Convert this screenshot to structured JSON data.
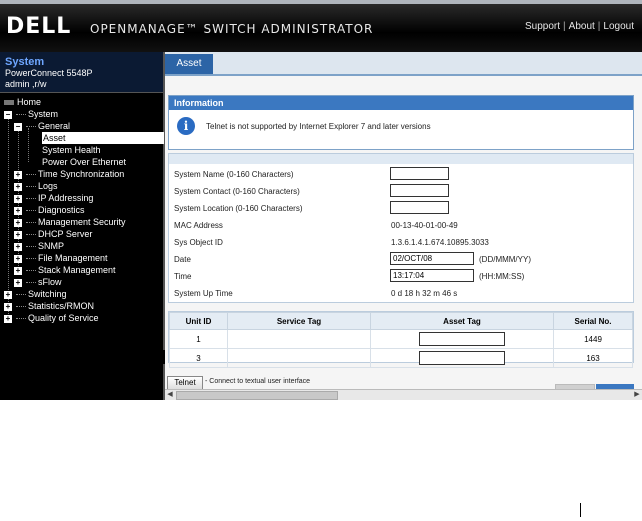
{
  "header": {
    "logo": "DELL",
    "title": "OPENMANAGE™ SWITCH ADMINISTRATOR",
    "links": [
      "Support",
      "About",
      "Logout"
    ]
  },
  "sidebar": {
    "system_title": "System",
    "model": "PowerConnect 5548P",
    "user": "admin ,r/w",
    "tree": [
      {
        "label": "Home",
        "toggle": ""
      },
      {
        "label": "System",
        "toggle": "−"
      },
      {
        "label": "General",
        "toggle": "−"
      },
      {
        "label": "Asset",
        "toggle": ""
      },
      {
        "label": "System Health",
        "toggle": ""
      },
      {
        "label": "Power Over Ethernet",
        "toggle": ""
      },
      {
        "label": "Time Synchronization",
        "toggle": "+"
      },
      {
        "label": "Logs",
        "toggle": "+"
      },
      {
        "label": "IP Addressing",
        "toggle": "+"
      },
      {
        "label": "Diagnostics",
        "toggle": "+"
      },
      {
        "label": "Management Security",
        "toggle": "+"
      },
      {
        "label": "DHCP Server",
        "toggle": "+"
      },
      {
        "label": "SNMP",
        "toggle": "+"
      },
      {
        "label": "File Management",
        "toggle": "+"
      },
      {
        "label": "Stack Management",
        "toggle": "+"
      },
      {
        "label": "sFlow",
        "toggle": "+"
      },
      {
        "label": "Switching",
        "toggle": "+"
      },
      {
        "label": "Statistics/RMON",
        "toggle": "+"
      },
      {
        "label": "Quality of Service",
        "toggle": "+"
      }
    ]
  },
  "main": {
    "tab": "Asset",
    "info": {
      "title": "Information",
      "icon": "i",
      "message": "Telnet is not supported by Internet Explorer 7 and later versions"
    },
    "form": [
      {
        "label": "System Name (0-160 Characters)",
        "type": "input",
        "value": "",
        "width": ""
      },
      {
        "label": "System Contact (0-160 Characters)",
        "type": "input",
        "value": ""
      },
      {
        "label": "System Location (0-160 Characters)",
        "type": "input",
        "value": ""
      },
      {
        "label": "MAC Address",
        "type": "text",
        "value": "00-13-40-01-00-49"
      },
      {
        "label": "Sys Object ID",
        "type": "text",
        "value": "1.3.6.1.4.1.674.10895.3033"
      },
      {
        "label": "Date",
        "type": "input",
        "value": "02/OCT/08",
        "unit": "(DD/MMM/YY)"
      },
      {
        "label": "Time",
        "type": "input",
        "value": "13:17:04",
        "unit": "(HH:MM:SS)"
      },
      {
        "label": "System Up Time",
        "type": "text",
        "value": "0 d 18 h 32 m 46 s"
      }
    ],
    "table": {
      "headers": [
        "Unit ID",
        "Service Tag",
        "Asset Tag",
        "Serial No."
      ],
      "rows": [
        {
          "unit": "1",
          "service": "",
          "asset": "",
          "serial": "1449"
        },
        {
          "unit": "3",
          "service": "",
          "asset": "",
          "serial": "163"
        }
      ]
    },
    "telnet": {
      "button": "Telnet",
      "text": "- Connect to textual user interface"
    }
  }
}
